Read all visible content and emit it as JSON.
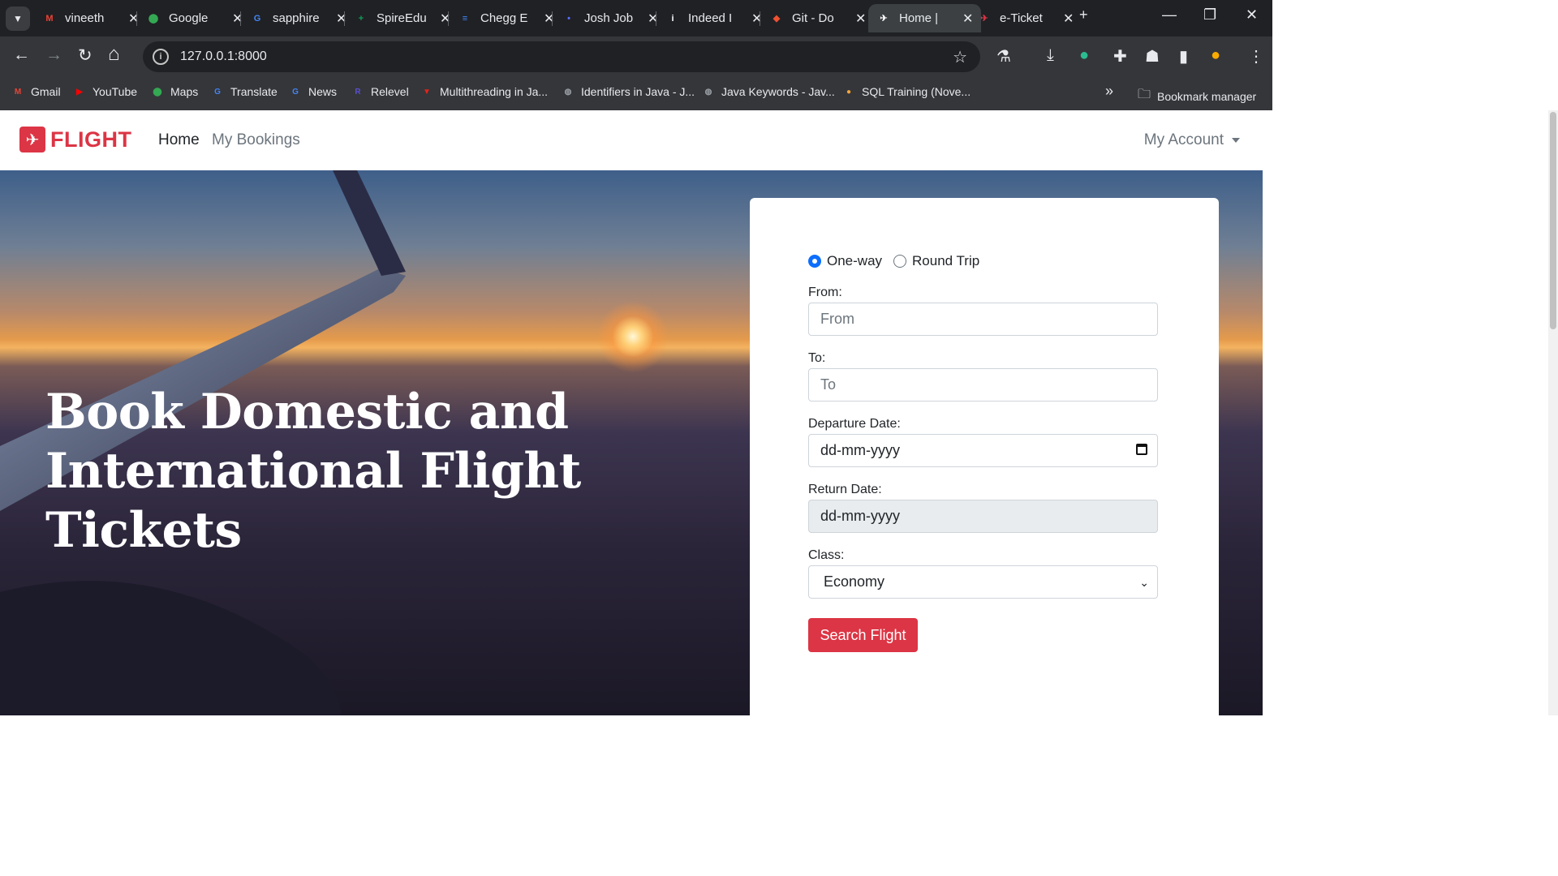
{
  "browser": {
    "tabs": [
      {
        "title": "vineeth",
        "icon": "gmail-icon",
        "color": "#ea4335",
        "glyph": "M"
      },
      {
        "title": "Google",
        "icon": "google-maps-icon",
        "color": "#34a853",
        "glyph": "⬤"
      },
      {
        "title": "sapphire",
        "icon": "google-icon",
        "color": "#4285f4",
        "glyph": "G"
      },
      {
        "title": "SpireEdu",
        "icon": "sheets-icon",
        "color": "#0f9d58",
        "glyph": "+"
      },
      {
        "title": "Chegg E",
        "icon": "docs-icon",
        "color": "#4285f4",
        "glyph": "≡"
      },
      {
        "title": "Josh Job",
        "icon": "josh-icon",
        "color": "#5b6cff",
        "glyph": "•"
      },
      {
        "title": "Indeed I",
        "icon": "indeed-icon",
        "color": "#ffffff",
        "glyph": "i"
      },
      {
        "title": "Git - Do",
        "icon": "git-icon",
        "color": "#f05133",
        "glyph": "◆"
      },
      {
        "title": "Home |",
        "icon": "site-favicon-icon",
        "color": "#ffffff",
        "glyph": "✈"
      },
      {
        "title": "e-Ticket",
        "icon": "flight-favicon-icon",
        "color": "#dc3545",
        "glyph": "✈"
      }
    ],
    "url": "127.0.0.1:8000",
    "bookmarks": [
      {
        "label": "Gmail",
        "icon": "gmail-icon",
        "color": "#ea4335",
        "glyph": "M"
      },
      {
        "label": "YouTube",
        "icon": "youtube-icon",
        "color": "#ff0000",
        "glyph": "▶"
      },
      {
        "label": "Maps",
        "icon": "maps-icon",
        "color": "#34a853",
        "glyph": "⬤"
      },
      {
        "label": "Translate",
        "icon": "translate-icon",
        "color": "#4285f4",
        "glyph": "G"
      },
      {
        "label": "News",
        "icon": "news-icon",
        "color": "#4285f4",
        "glyph": "G"
      },
      {
        "label": "Relevel",
        "icon": "relevel-icon",
        "color": "#5a4fcf",
        "glyph": "R"
      },
      {
        "label": "Multithreading in Ja...",
        "icon": "v-icon",
        "color": "#e2231a",
        "glyph": "▼"
      },
      {
        "label": "Identifiers in Java - J...",
        "icon": "globe-icon",
        "color": "#9aa0a6",
        "glyph": "◍"
      },
      {
        "label": "Java Keywords - Jav...",
        "icon": "globe-icon",
        "color": "#9aa0a6",
        "glyph": "◍"
      },
      {
        "label": "SQL Training (Nove...",
        "icon": "sql-icon",
        "color": "#f4a53a",
        "glyph": "●"
      }
    ],
    "bookmark_manager": "Bookmark manager"
  },
  "site": {
    "brand": "FLIGHT",
    "nav": {
      "home": "Home",
      "bookings": "My Bookings",
      "account": "My Account"
    },
    "hero_title": "Book Domestic and International Flight Tickets",
    "form": {
      "trip_one_way": "One-way",
      "trip_round": "Round Trip",
      "selected_trip": "One-way",
      "from_label": "From:",
      "from_placeholder": "From",
      "to_label": "To:",
      "to_placeholder": "To",
      "departure_label": "Departure Date:",
      "departure_value": "dd-mm-yyyy",
      "return_label": "Return Date:",
      "return_value": "dd-mm-yyyy",
      "class_label": "Class:",
      "class_value": "Economy",
      "submit": "Search Flight"
    }
  },
  "colors": {
    "brand": "#dc3545",
    "primary": "#0d6efd",
    "chrome_dark": "#202124",
    "chrome_mid": "#35363a"
  }
}
